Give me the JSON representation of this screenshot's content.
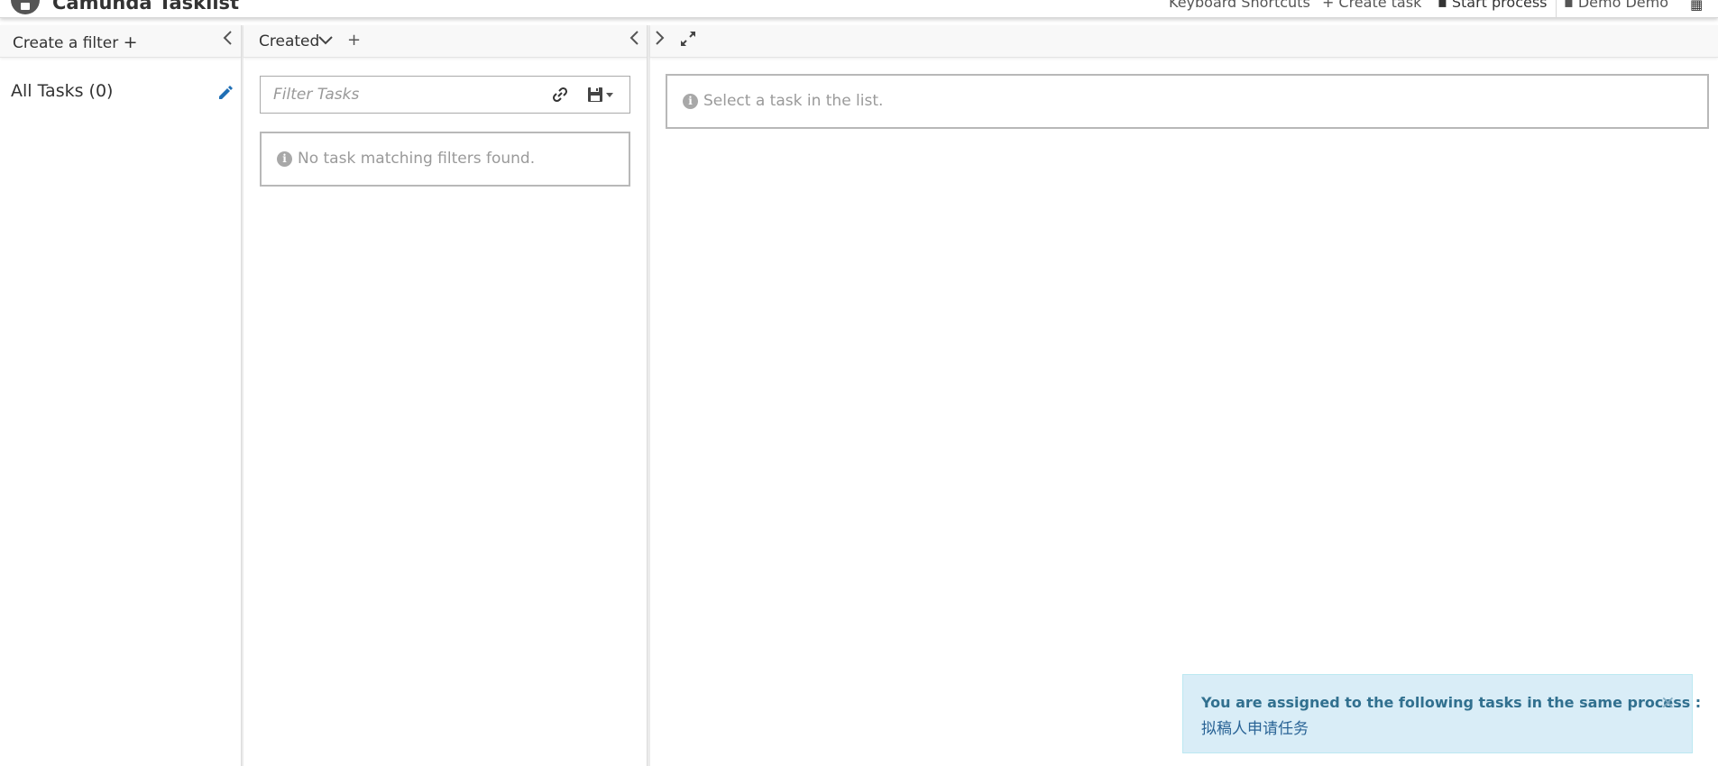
{
  "header": {
    "brand": "Camunda Tasklist",
    "keyboard_shortcuts": "Keyboard Shortcuts",
    "create_task": "Create task",
    "start_process": "Start process",
    "user": "Demo Demo",
    "icons": [
      "camunda-logo-icon",
      "keyboard-icon",
      "plus-icon",
      "start-process-icon",
      "user-icon",
      "apps-grid-icon"
    ]
  },
  "filters": {
    "create_label": "Create a filter",
    "create_icon": "+",
    "collapse_icon": "‹",
    "items": [
      {
        "label": "All Tasks (0)"
      }
    ]
  },
  "list": {
    "sort_label": "Created",
    "add_sort_icon": "+",
    "collapse_icon": "‹",
    "search": {
      "placeholder": "Filter Tasks"
    },
    "empty_message": "No task matching filters found."
  },
  "detail": {
    "expand_icon": "›",
    "empty_message": "Select a task in the list."
  },
  "notification": {
    "title": "You are assigned to the following tasks in the same process :",
    "task_link": "拟稿人申请任务",
    "close": "×"
  },
  "colors": {
    "notification_bg": "#d9edf7",
    "notification_text": "#31708f",
    "edit_icon": "#1f6fb5",
    "info_text": "#9a9a9a"
  }
}
